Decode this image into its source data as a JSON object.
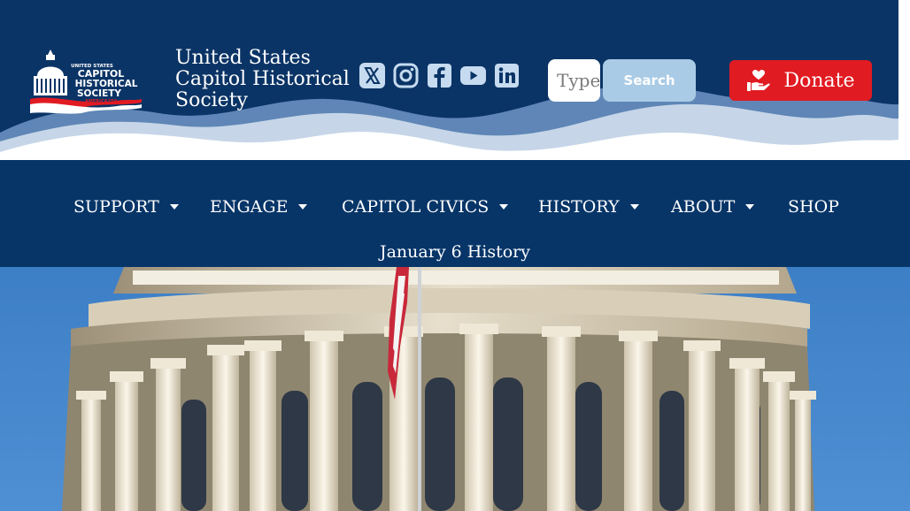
{
  "header": {
    "site_title": "United States Capitol Historical Society",
    "logo": {
      "line1": "UNITED STATES",
      "line2": "CAPITOL",
      "line3": "HISTORICAL",
      "line4": "SOCIETY",
      "line5": "AMERICA250"
    },
    "socials": [
      {
        "name": "x-icon"
      },
      {
        "name": "instagram-icon"
      },
      {
        "name": "facebook-icon"
      },
      {
        "name": "youtube-icon"
      },
      {
        "name": "linkedin-icon"
      }
    ],
    "search": {
      "placeholder": "Type",
      "button_label": "Search"
    },
    "donate_label": "Donate",
    "colors": {
      "header_bg": "#0b3466",
      "donate_red": "#e11b22",
      "search_button": "#a9cbe6"
    }
  },
  "nav": {
    "items": [
      {
        "label": "SUPPORT",
        "has_dropdown": true
      },
      {
        "label": "ENGAGE",
        "has_dropdown": true
      },
      {
        "label": "CAPITOL CIVICS",
        "has_dropdown": true
      },
      {
        "label": "HISTORY",
        "has_dropdown": true
      },
      {
        "label": "ABOUT",
        "has_dropdown": true
      },
      {
        "label": "SHOP",
        "has_dropdown": false
      }
    ],
    "second_row": "January 6 History"
  }
}
